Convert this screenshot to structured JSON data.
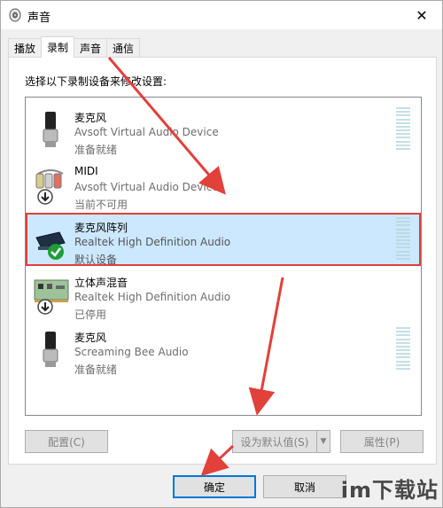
{
  "window": {
    "title": "声音",
    "close_glyph": "✕"
  },
  "tabs": [
    {
      "label": "播放",
      "active": false
    },
    {
      "label": "录制",
      "active": true
    },
    {
      "label": "声音",
      "active": false
    },
    {
      "label": "通信",
      "active": false
    }
  ],
  "instruction": "选择以下录制设备来修改设置:",
  "devices": [
    {
      "name": "麦克风",
      "description": "Avsoft Virtual Audio Device",
      "status": "准备就绪",
      "icon": "microphone-icon",
      "badge": null,
      "selected": false
    },
    {
      "name": "MIDI",
      "description": "Avsoft Virtual Audio Device",
      "status": "当前不可用",
      "icon": "midi-cable-icon",
      "badge": "down-arrow-badge",
      "selected": false
    },
    {
      "name": "麦克风阵列",
      "description": "Realtek High Definition Audio",
      "status": "默认设备",
      "icon": "microphone-array-icon",
      "badge": "green-check-badge",
      "selected": true
    },
    {
      "name": "立体声混音",
      "description": "Realtek High Definition Audio",
      "status": "已停用",
      "icon": "sound-card-icon",
      "badge": "down-arrow-badge",
      "selected": false
    },
    {
      "name": "麦克风",
      "description": "Screaming Bee Audio",
      "status": "准备就绪",
      "icon": "microphone-icon",
      "badge": null,
      "selected": false
    }
  ],
  "buttons": {
    "configure": "配置(C)",
    "set_default": "设为默认值(S)",
    "properties": "属性(P)",
    "ok": "确定",
    "cancel": "取消"
  },
  "watermark": "im下载站",
  "colors": {
    "selection": "#cce8ff",
    "annotation_red": "#e2403a",
    "accent": "#0078d7"
  }
}
